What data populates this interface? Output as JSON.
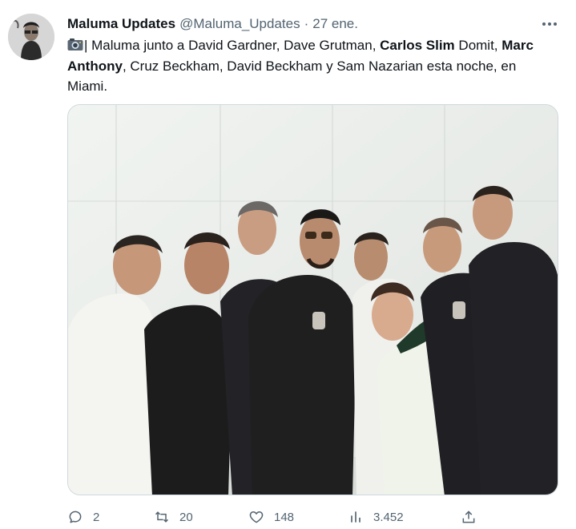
{
  "tweet": {
    "author_name": "Maluma Updates",
    "author_handle": "@Maluma_Updates",
    "separator": "·",
    "time": "27 ene.",
    "text_parts": {
      "emoji": "camera-emoji",
      "p1": "| Maluma junto a David Gardner, Dave Grutman, ",
      "b1": "Carlos Slim",
      "p2": " Domit, ",
      "b2": "Marc Anthony",
      "p3": ", Cruz Beckham, David Beckham y Sam Nazarian esta noche, en Miami."
    },
    "photo_description_icon": "group-photo"
  },
  "actions": {
    "replies": "2",
    "retweets": "20",
    "likes": "148",
    "views": "3.452"
  },
  "icons": {
    "reply": "reply-icon",
    "retweet": "retweet-icon",
    "like": "heart-icon",
    "views": "views-icon",
    "share": "share-icon",
    "more": "more-icon"
  },
  "colors": {
    "text": "#0f1419",
    "secondary": "#536471",
    "border": "#cfd9de"
  }
}
